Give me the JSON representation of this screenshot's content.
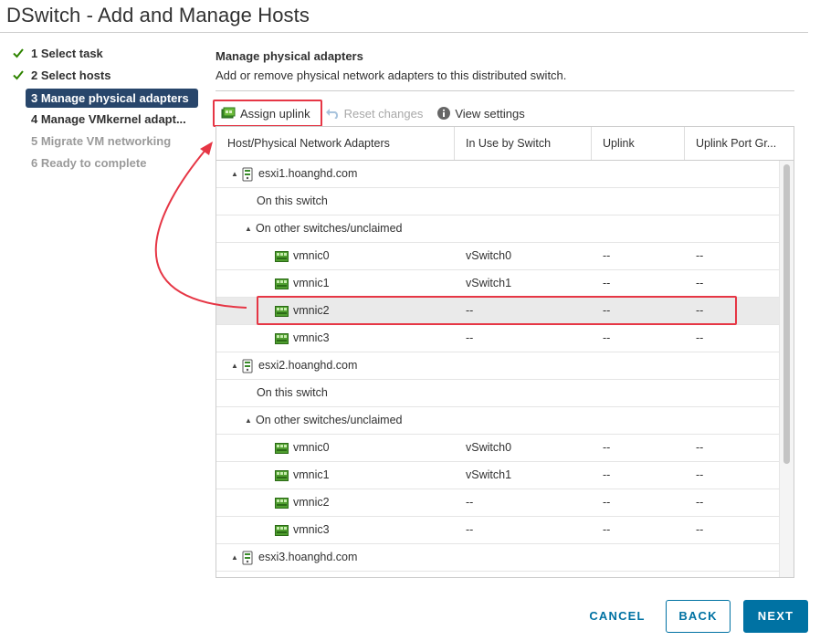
{
  "window": {
    "title": "DSwitch - Add and Manage Hosts"
  },
  "steps": [
    {
      "label": "1 Select task",
      "state": "done"
    },
    {
      "label": "2 Select hosts",
      "state": "done"
    },
    {
      "label": "3 Manage physical adapters",
      "state": "active"
    },
    {
      "label": "4 Manage VMkernel adapt...",
      "state": "normal"
    },
    {
      "label": "5 Migrate VM networking",
      "state": "disabled"
    },
    {
      "label": "6 Ready to complete",
      "state": "disabled"
    }
  ],
  "main": {
    "title": "Manage physical adapters",
    "subtitle": "Add or remove physical network adapters to this distributed switch."
  },
  "toolbar": {
    "assign_uplink": "Assign uplink",
    "reset_changes": "Reset changes",
    "view_settings": "View settings"
  },
  "grid": {
    "columns": [
      "Host/Physical Network Adapters",
      "In Use by Switch",
      "Uplink",
      "Uplink Port Gr..."
    ],
    "rows": [
      {
        "type": "host",
        "name": "esxi1.hoanghd.com"
      },
      {
        "type": "group",
        "name": "On this switch"
      },
      {
        "type": "group-expand",
        "name": "On other switches/unclaimed"
      },
      {
        "type": "nic",
        "name": "vmnic0",
        "switch": "vSwitch0",
        "uplink": "--",
        "portgroup": "--"
      },
      {
        "type": "nic",
        "name": "vmnic1",
        "switch": "vSwitch1",
        "uplink": "--",
        "portgroup": "--"
      },
      {
        "type": "nic",
        "name": "vmnic2",
        "switch": "--",
        "uplink": "--",
        "portgroup": "--",
        "selected": true
      },
      {
        "type": "nic",
        "name": "vmnic3",
        "switch": "--",
        "uplink": "--",
        "portgroup": "--"
      },
      {
        "type": "host",
        "name": "esxi2.hoanghd.com"
      },
      {
        "type": "group",
        "name": "On this switch"
      },
      {
        "type": "group-expand",
        "name": "On other switches/unclaimed"
      },
      {
        "type": "nic",
        "name": "vmnic0",
        "switch": "vSwitch0",
        "uplink": "--",
        "portgroup": "--"
      },
      {
        "type": "nic",
        "name": "vmnic1",
        "switch": "vSwitch1",
        "uplink": "--",
        "portgroup": "--"
      },
      {
        "type": "nic",
        "name": "vmnic2",
        "switch": "--",
        "uplink": "--",
        "portgroup": "--"
      },
      {
        "type": "nic",
        "name": "vmnic3",
        "switch": "--",
        "uplink": "--",
        "portgroup": "--"
      },
      {
        "type": "host",
        "name": "esxi3.hoanghd.com"
      },
      {
        "type": "group",
        "name": ""
      }
    ]
  },
  "footer": {
    "cancel": "CANCEL",
    "back": "BACK",
    "next": "NEXT"
  },
  "colors": {
    "accent": "#0072a3",
    "active_step": "#28466b",
    "annotation_red": "#e63645",
    "check_green": "#2f8400"
  }
}
